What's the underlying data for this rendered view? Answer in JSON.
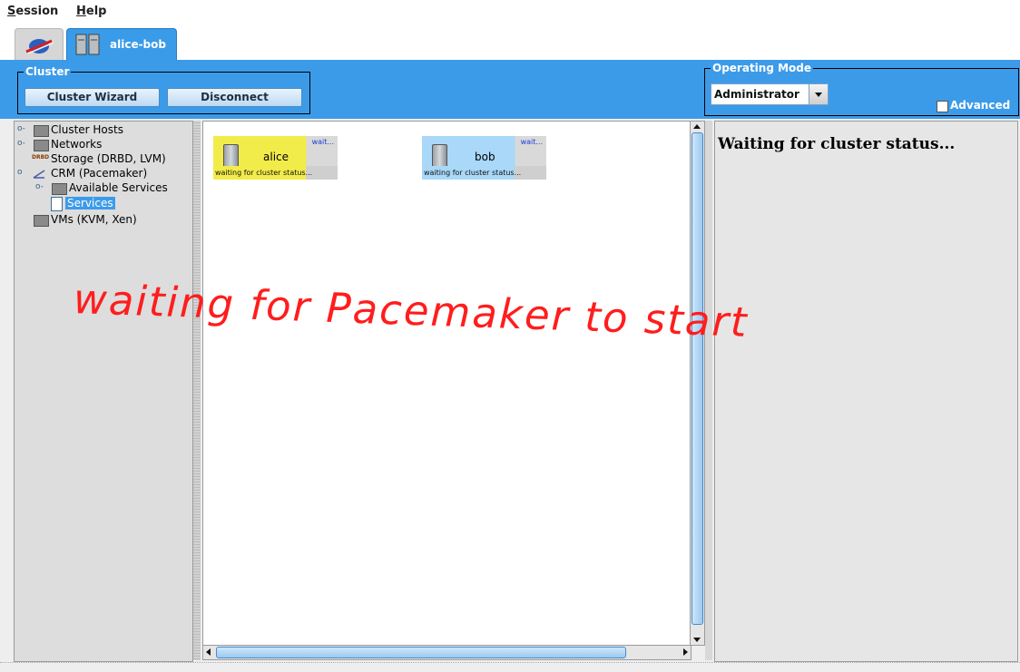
{
  "menubar": {
    "session": "Session",
    "session_mnemonic": "S",
    "session_rest": "ession",
    "help_mnemonic": "H",
    "help_rest": "elp"
  },
  "tabs": {
    "cluster_tab_label": "alice-bob"
  },
  "cluster_group": {
    "title": "Cluster",
    "wizard_button": "Cluster Wizard",
    "disconnect_button": "Disconnect"
  },
  "operating_mode": {
    "title": "Operating Mode",
    "selected": "Administrator",
    "advanced_label": "Advanced",
    "advanced_checked": false
  },
  "tree": {
    "cluster_hosts": "Cluster Hosts",
    "networks": "Networks",
    "storage": "Storage (DRBD, LVM)",
    "crm": "CRM (Pacemaker)",
    "available_services": "Available Services",
    "services": "Services",
    "vms": "VMs (KVM, Xen)",
    "drbd_badge": "DRBD"
  },
  "nodes": [
    {
      "name": "alice",
      "wait": "wait...",
      "status": "waiting for cluster status...",
      "color": "#f2ec4a"
    },
    {
      "name": "bob",
      "wait": "wait...",
      "status": "waiting for cluster status...",
      "color": "#a9d8f8"
    }
  ],
  "overlay_text": "waiting for Pacemaker to start",
  "right_status": "Waiting for cluster status..."
}
